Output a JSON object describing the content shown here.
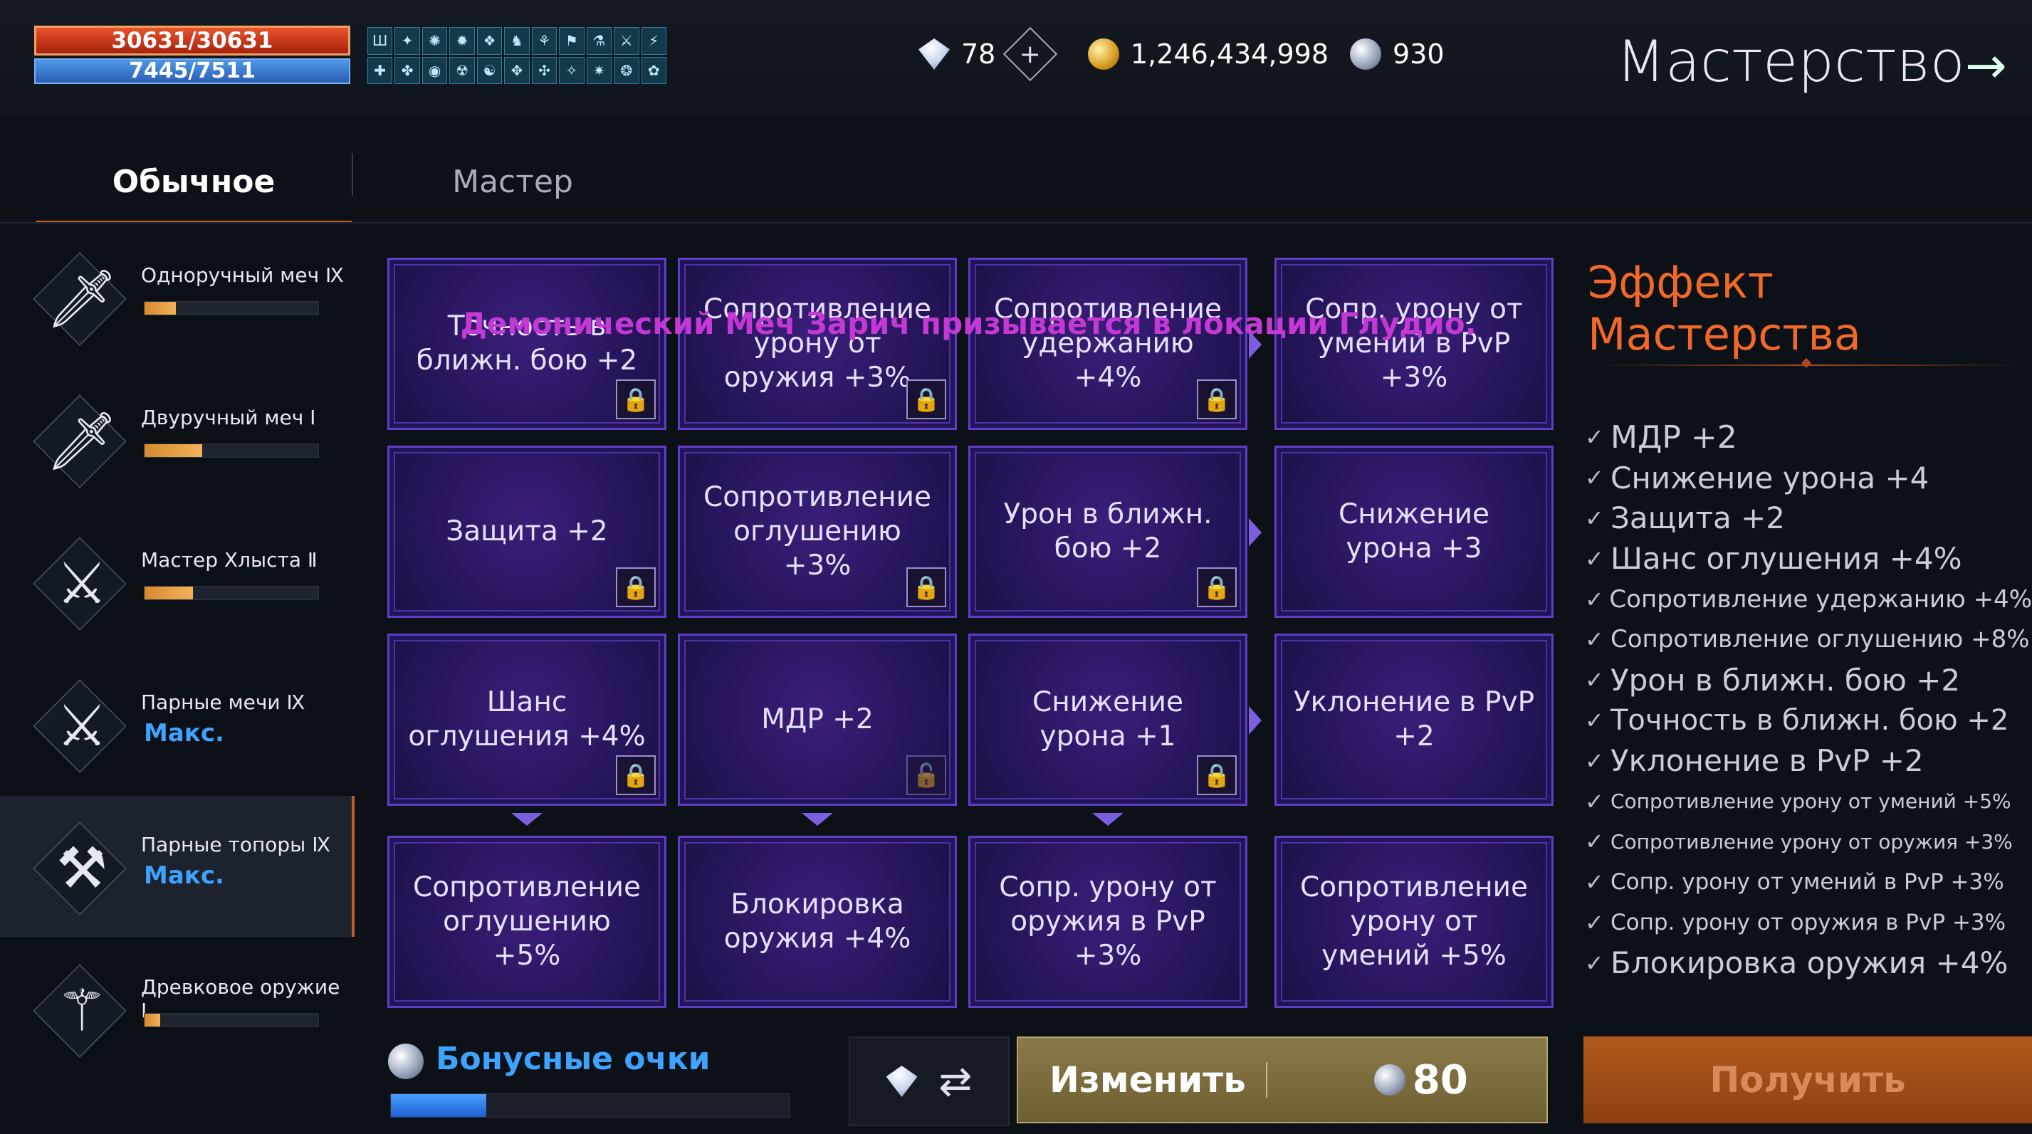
{
  "player": {
    "hp": "30631/30631",
    "mp": "7445/7511"
  },
  "currencies": {
    "diamonds": "78",
    "gold": "1,246,434,998",
    "silver": "930"
  },
  "page_title": "Мастерство",
  "tabs": [
    {
      "label": "Обычное"
    },
    {
      "label": "Мастер"
    }
  ],
  "weapons": [
    {
      "name": "Одноручный меч Ⅸ",
      "progress": 0.18
    },
    {
      "name": "Двуручный меч Ⅰ",
      "progress": 0.33
    },
    {
      "name": "Мастер Хлыста Ⅱ",
      "progress": 0.28
    },
    {
      "name": "Парные мечи Ⅸ",
      "max_label": "Макс."
    },
    {
      "name": "Парные топоры Ⅸ",
      "max_label": "Макс."
    },
    {
      "name": "Древковое оружие Ⅰ",
      "progress": 0.09
    }
  ],
  "notice": "Демонический Меч Зарич призывается в локации Глудио.",
  "grid": {
    "rows": [
      [
        "Точность в ближн. бою +2",
        "Сопротивление урону от оружия +3%",
        "Сопротивление удержанию +4%",
        "Сопр. урону от умений в PvP +3%"
      ],
      [
        "Защита +2",
        "Сопротивление оглушению +3%",
        "Урон в ближн. бою +2",
        "Снижение урона +3"
      ],
      [
        "Шанс оглушения +4%",
        "МДР +2",
        "Снижение урона +1",
        "Уклонение в PvP +2"
      ],
      [
        "Сопротивление оглушению +5%",
        "Блокировка оружия +4%",
        "Сопр. урону от оружия в PvP +3%",
        "Сопротивление урону от умений +5%"
      ]
    ]
  },
  "effects_title": "Эффект Мастерства",
  "effects": [
    "МДР +2",
    "Снижение урона +4",
    "Защита +2",
    "Шанс оглушения +4%",
    "Сопротивление удержанию +4%",
    "Сопротивление оглушению +8%",
    "Урон в ближн. бою +2",
    "Точность в ближн. бою +2",
    "Уклонение в PvP +2",
    "Сопротивление урону от умений +5%",
    "Сопротивление урону от оружия +3%",
    "Сопр. урону от умений в PvP +3%",
    "Сопр. урону от оружия в PvP +3%",
    "Блокировка оружия +4%"
  ],
  "bonus": {
    "label": "Бонусные очки",
    "progress": 0.24
  },
  "buttons": {
    "change": "Изменить",
    "change_cost": "80",
    "get": "Получить"
  }
}
